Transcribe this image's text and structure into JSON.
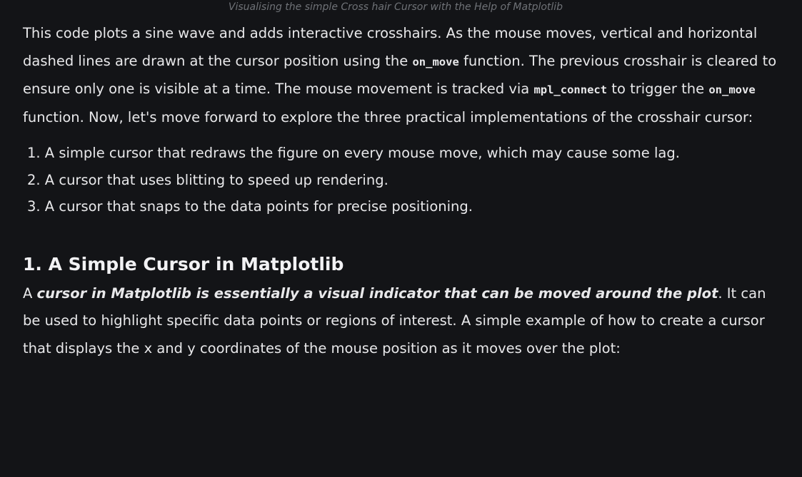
{
  "caption": "Visualising the simple Cross hair Cursor with the Help of Matplotlib",
  "intro": {
    "t1": "This code plots a sine wave and adds interactive crosshairs. As the mouse moves, vertical and horizontal dashed lines are drawn at the cursor position using the ",
    "c1": "on_move",
    "t2": " function. The previous crosshair is cleared to ensure only one is visible at a time. The mouse movement is tracked via ",
    "c2": "mpl_connect",
    "t3": " to trigger the ",
    "c3": "on_move",
    "t4": " function. Now, let's move forward to explore the three practical implementations of the crosshair cursor:"
  },
  "list": [
    "1. A simple cursor that redraws the figure on every mouse move, which may cause some lag.",
    "2. A cursor that uses blitting to speed up rendering.",
    "3. A cursor that snaps to the data points for precise positioning."
  ],
  "section": {
    "heading": "1. A Simple Cursor in Matplotlib",
    "t1": "A ",
    "emphasis": "cursor in Matplotlib is essentially a visual indicator that can be moved around the plot",
    "t2": ". It can be used to highlight specific data points or regions of interest. A simple example of how to create a cursor that displays the x and y coordinates of the mouse position as it moves over the plot:"
  }
}
